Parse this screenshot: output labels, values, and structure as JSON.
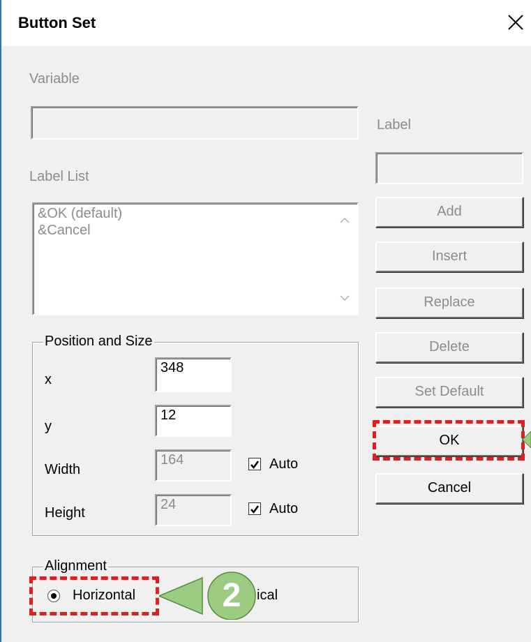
{
  "window": {
    "title": "Button Set"
  },
  "variable": {
    "label": "Variable",
    "value": ""
  },
  "label_field": {
    "label": "Label",
    "value": ""
  },
  "label_list": {
    "label": "Label List",
    "items": [
      "&OK (default)",
      "&Cancel"
    ]
  },
  "buttons": {
    "add": "Add",
    "insert": "Insert",
    "replace": "Replace",
    "delete": "Delete",
    "set_default": "Set Default",
    "ok": "OK",
    "cancel": "Cancel"
  },
  "position_size": {
    "title": "Position and Size",
    "x_label": "x",
    "x_value": "348",
    "y_label": "y",
    "y_value": "12",
    "width_label": "Width",
    "width_value": "164",
    "height_label": "Height",
    "height_value": "24",
    "auto_label": "Auto",
    "width_auto": true,
    "height_auto": true
  },
  "alignment": {
    "title": "Alignment",
    "horizontal_label": "Horizontal",
    "vertical_label_visible": "ical",
    "selected": "Horizontal"
  },
  "callout": {
    "number": "2",
    "color": "#9ccc82"
  },
  "highlight_color": "#e02020"
}
